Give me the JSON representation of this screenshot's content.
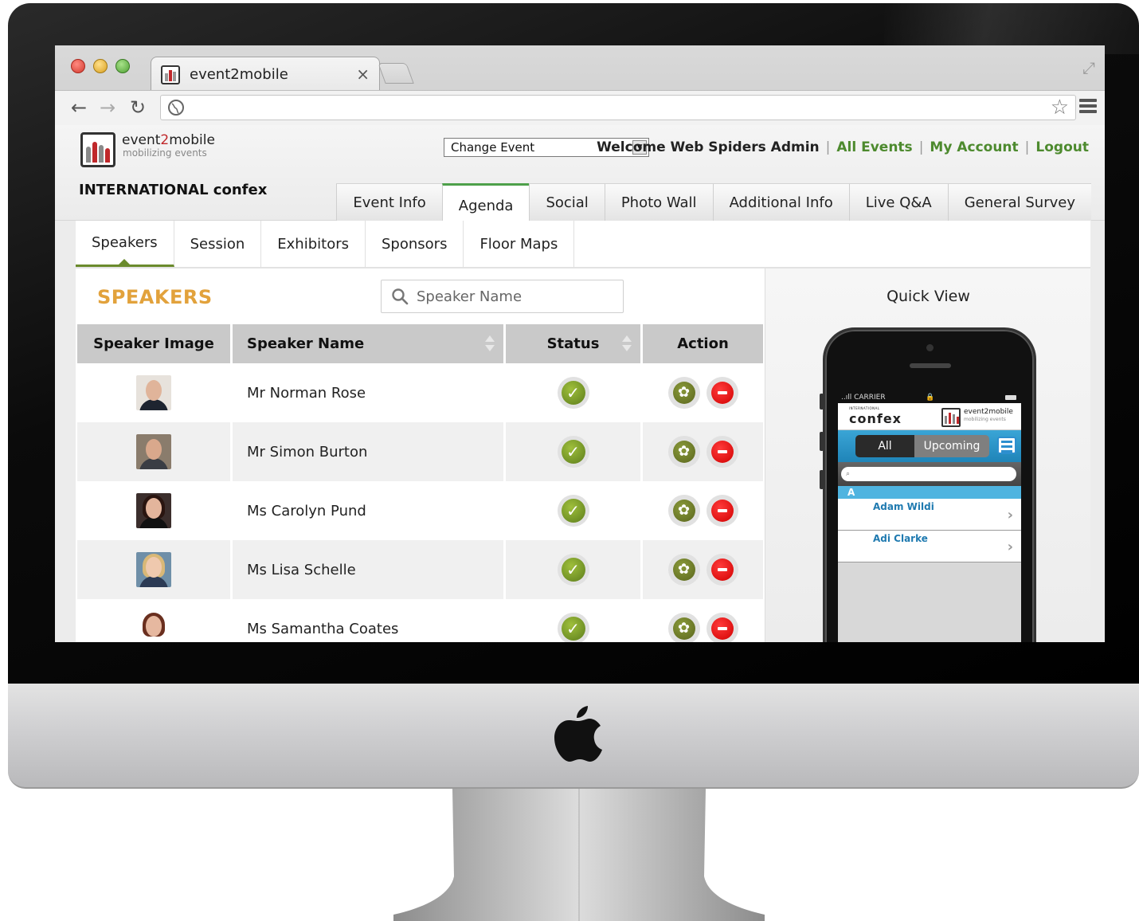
{
  "browser": {
    "tab_title": "event2mobile",
    "tab_close": "×",
    "icons": [
      "back-arrow-icon",
      "forward-arrow-icon",
      "reload-icon",
      "globe-icon",
      "star-icon",
      "menu-icon"
    ]
  },
  "header": {
    "logo_name_a": "event",
    "logo_name_b": "2",
    "logo_name_c": "mobile",
    "logo_tagline": "mobilizing events",
    "change_event": "Change Event",
    "welcome": "Welcome Web Spiders Admin",
    "all_events": "All Events",
    "my_account": "My Account",
    "logout": "Logout",
    "event_title": "INTERNATIONAL confex"
  },
  "main_tabs": [
    {
      "label": "Event Info"
    },
    {
      "label": "Agenda"
    },
    {
      "label": "Social"
    },
    {
      "label": "Photo Wall"
    },
    {
      "label": "Additional Info"
    },
    {
      "label": "Live Q&A"
    },
    {
      "label": "General Survey"
    }
  ],
  "sub_tabs": [
    {
      "label": "Speakers"
    },
    {
      "label": "Session"
    },
    {
      "label": "Exhibitors"
    },
    {
      "label": "Sponsors"
    },
    {
      "label": "Floor Maps"
    }
  ],
  "speakers": {
    "heading": "SPEAKERS",
    "search_placeholder": "Speaker Name",
    "columns": [
      "Speaker Image",
      "Speaker Name",
      "Status",
      "Action"
    ],
    "rows": [
      {
        "name": "Mr Norman Rose"
      },
      {
        "name": "Mr Simon Burton"
      },
      {
        "name": "Ms Carolyn Pund"
      },
      {
        "name": "Ms Lisa Schelle"
      },
      {
        "name": "Ms Samantha Coates"
      }
    ]
  },
  "quick_view": {
    "title": "Quick View",
    "phone": {
      "carrier": "..ıll CARRIER",
      "app_name": "confex",
      "app_small": "INTERNATIONAL",
      "logo_name": "event2mobile",
      "logo_tagline": "mobilizing events",
      "seg_all": "All",
      "seg_upcoming": "Upcoming",
      "letter": "A",
      "items": [
        "Adam Wildi",
        "Adi Clarke"
      ]
    }
  },
  "colors": {
    "accent_green": "#4d8a2e",
    "heading_orange": "#e2a23c",
    "delete_red": "#d10000"
  }
}
